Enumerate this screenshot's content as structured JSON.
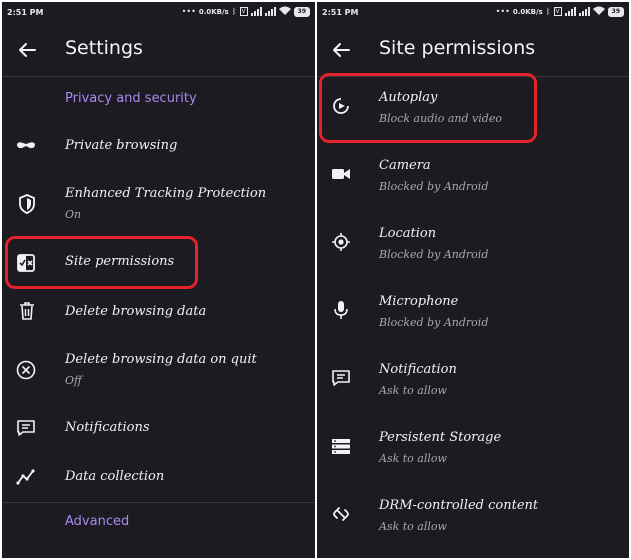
{
  "left": {
    "status": {
      "time": "2:51 PM",
      "speed": "0.0KB/s",
      "battery": "39"
    },
    "title": "Settings",
    "section_privacy": "Privacy and security",
    "items": [
      {
        "icon": "mask-icon",
        "title": "Private browsing",
        "subtitle": ""
      },
      {
        "icon": "shield-icon",
        "title": "Enhanced Tracking Protection",
        "subtitle": "On"
      },
      {
        "icon": "site-permissions-icon",
        "title": "Site permissions",
        "subtitle": ""
      },
      {
        "icon": "trash-icon",
        "title": "Delete browsing data",
        "subtitle": ""
      },
      {
        "icon": "cancel-circle-icon",
        "title": "Delete browsing data on quit",
        "subtitle": "Off"
      },
      {
        "icon": "notification-icon",
        "title": "Notifications",
        "subtitle": ""
      },
      {
        "icon": "chart-line-icon",
        "title": "Data collection",
        "subtitle": ""
      }
    ],
    "section_advanced": "Advanced"
  },
  "right": {
    "status": {
      "time": "2:51 PM",
      "speed": "0.0KB/s",
      "battery": "39"
    },
    "title": "Site permissions",
    "items": [
      {
        "icon": "autoplay-icon",
        "title": "Autoplay",
        "subtitle": "Block audio and video"
      },
      {
        "icon": "camera-icon",
        "title": "Camera",
        "subtitle": "Blocked by Android"
      },
      {
        "icon": "location-icon",
        "title": "Location",
        "subtitle": "Blocked by Android"
      },
      {
        "icon": "microphone-icon",
        "title": "Microphone",
        "subtitle": "Blocked by Android"
      },
      {
        "icon": "notification-icon",
        "title": "Notification",
        "subtitle": "Ask to allow"
      },
      {
        "icon": "storage-icon",
        "title": "Persistent Storage",
        "subtitle": "Ask to allow"
      },
      {
        "icon": "drm-icon",
        "title": "DRM-controlled content",
        "subtitle": "Ask to allow"
      }
    ]
  },
  "colors": {
    "background": "#1d1b22",
    "accent": "#a889ef",
    "highlight": "#e3222a",
    "text": "#f2f1f4",
    "subtext": "#a8a6ae"
  }
}
